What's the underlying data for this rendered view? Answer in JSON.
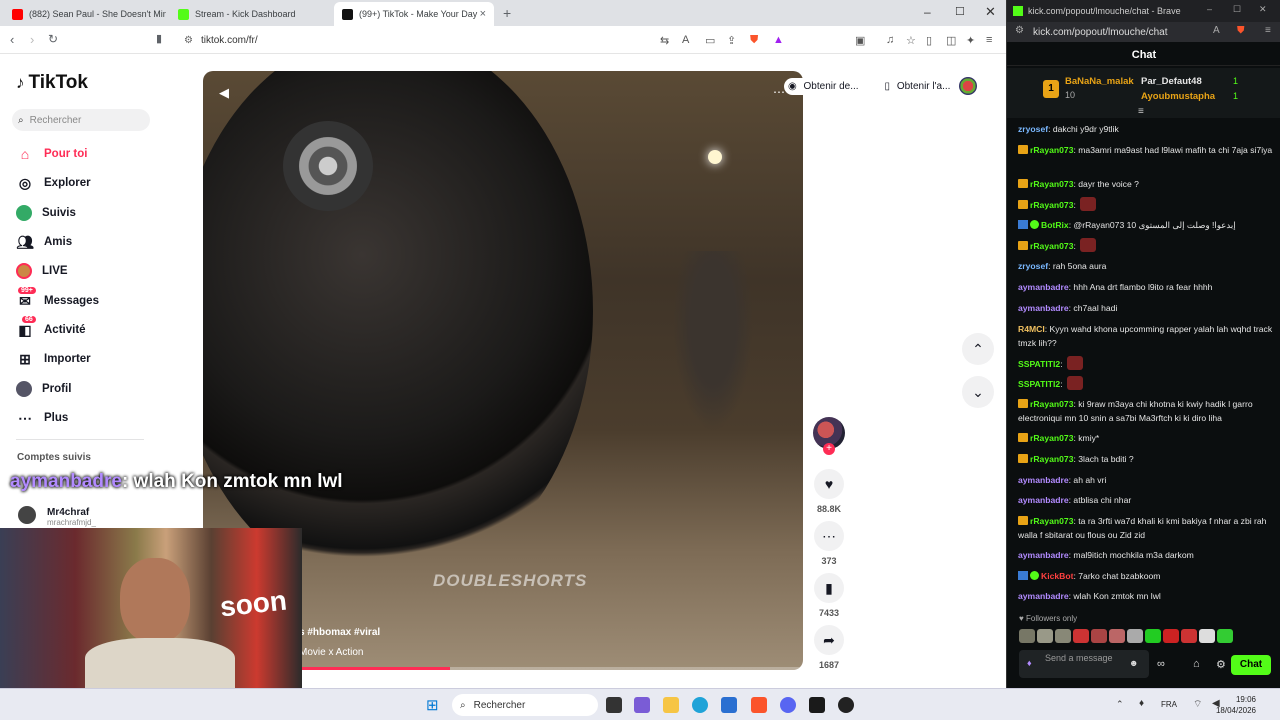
{
  "browser": {
    "tabs": [
      {
        "title": "(882) Sean Paul - She Doesn't Mind |",
        "icon": "youtube-icon"
      },
      {
        "title": "Stream - Kick Dashboard",
        "icon": "kick-icon"
      },
      {
        "title": "(99+) TikTok - Make Your Day",
        "icon": "tiktok-icon"
      }
    ],
    "url": "tiktok.com/fr/"
  },
  "sidebar": {
    "logo": "TikTok",
    "search_placeholder": "Rechercher",
    "items": [
      {
        "label": "Pour toi",
        "icon": "home-icon"
      },
      {
        "label": "Explorer",
        "icon": "compass-icon"
      },
      {
        "label": "Suivis",
        "icon": "following-icon"
      },
      {
        "label": "Amis",
        "icon": "friends-icon"
      },
      {
        "label": "LIVE",
        "icon": "live-icon"
      },
      {
        "label": "Messages",
        "icon": "messages-icon",
        "badge": "99+"
      },
      {
        "label": "Activité",
        "icon": "activity-icon",
        "badge": "66"
      },
      {
        "label": "Importer",
        "icon": "upload-icon"
      },
      {
        "label": "Profil",
        "icon": "profile-icon"
      },
      {
        "label": "Plus",
        "icon": "more-icon"
      }
    ],
    "followed_title": "Comptes suivis",
    "accounts": [
      {
        "name": "Mr4chraf",
        "handle": "mrachrafmjd_"
      }
    ]
  },
  "video": {
    "watermark": "DOUBLESHORTS",
    "tags": "s #hbomax #viral",
    "music": "Movie x Action",
    "progress": 0.3
  },
  "top_buttons": [
    "Obtenir de...",
    "Obtenir l'a..."
  ],
  "actions": {
    "likes": "88.8K",
    "comments": "373",
    "saves": "7433",
    "shares": "1687"
  },
  "overlay": {
    "user": "aymanbadre",
    "text": ": wlah Kon zmtok mn lwl"
  },
  "webcam": {
    "sign": "soon"
  },
  "taskbar": {
    "search": "Rechercher",
    "lang": "FRA",
    "time": "19:06",
    "date": "18/04/2026"
  },
  "kick": {
    "title": "kick.com/popout/lmouche/chat - Brave",
    "url": "kick.com/popout/lmouche/chat",
    "header": "Chat",
    "leaders": [
      {
        "rank": "1",
        "name": "BaNaNa_malak",
        "count": "10"
      },
      {
        "name": "Par_Defaut48",
        "count": "1"
      },
      {
        "name": "Ayoubmustapha",
        "count": "1"
      }
    ],
    "messages": [
      {
        "user": "zryosef",
        "color": "#7ab8ff",
        "badge": "none",
        "text": ": dakchi y9dr y9tlik"
      },
      {
        "user": "rRayan073",
        "color": "#53fc18",
        "badge": "crown",
        "text": ": ma3amri ma9ast had l9lawi mafih ta chi 7aja si7iya"
      },
      {
        "user": "rRayan073",
        "color": "#53fc18",
        "badge": "crown",
        "text": ": dayr the voice ?"
      },
      {
        "user": "rRayan073",
        "color": "#53fc18",
        "badge": "crown",
        "text": ":",
        "emote": true
      },
      {
        "user": "BotRix",
        "color": "#53fc18",
        "badge": "bot",
        "text": ": @rRayan073 10 إبدعوا! وصلت إلى المستوى"
      },
      {
        "user": "rRayan073",
        "color": "#53fc18",
        "badge": "crown",
        "text": ":",
        "emote": true
      },
      {
        "user": "zryosef",
        "color": "#7ab8ff",
        "badge": "none",
        "text": ": rah 5ona aura"
      },
      {
        "user": "aymanbadre",
        "color": "#b28bff",
        "badge": "none",
        "text": ": hhh Ana drt flambo l9ito ra fear hhhh"
      },
      {
        "user": "aymanbadre",
        "color": "#b28bff",
        "badge": "none",
        "text": ": ch7aal hadi"
      },
      {
        "user": "R4MCI",
        "color": "#f0c060",
        "badge": "none",
        "text": ": Kyyn wahd khona upcomming rapper yalah lah wqhd track tmzk lih??"
      },
      {
        "user": "SSPATITI2",
        "color": "#53fc18",
        "badge": "none",
        "text": ":",
        "emote": true
      },
      {
        "user": "SSPATITI2",
        "color": "#53fc18",
        "badge": "none",
        "text": ":",
        "emote": true
      },
      {
        "user": "rRayan073",
        "color": "#53fc18",
        "badge": "crown",
        "text": ": ki 9raw m3aya chi khotna ki kwiy hadik l garro electroniqui mn 10 snin a sa7bi Ma3rftch ki ki diro liha"
      },
      {
        "user": "rRayan073",
        "color": "#53fc18",
        "badge": "crown",
        "text": ": kmiy*"
      },
      {
        "user": "rRayan073",
        "color": "#53fc18",
        "badge": "crown",
        "text": ": 3lach ta bditi ?"
      },
      {
        "user": "aymanbadre",
        "color": "#b28bff",
        "badge": "none",
        "text": ": ah ah vri"
      },
      {
        "user": "aymanbadre",
        "color": "#b28bff",
        "badge": "none",
        "text": ": atblisa chi nhar"
      },
      {
        "user": "rRayan073",
        "color": "#53fc18",
        "badge": "crown",
        "text": ": ta ra 3rfti wa7d khali ki kmi bakiya f nhar a zbi rah walla f sbitarat ou flous ou Zid zid"
      },
      {
        "user": "aymanbadre",
        "color": "#b28bff",
        "badge": "none",
        "text": ": mal9itich mochkila m3a darkom"
      },
      {
        "user": "KickBot",
        "color": "#ff4040",
        "badge": "bot",
        "text": ": 7arko chat bzabkoom"
      },
      {
        "user": "aymanbadre",
        "color": "#b28bff",
        "badge": "none",
        "text": ": wlah Kon zmtok mn lwl"
      }
    ],
    "followers_only": "Followers only",
    "input_placeholder": "Send a message",
    "chat_button": "Chat"
  }
}
